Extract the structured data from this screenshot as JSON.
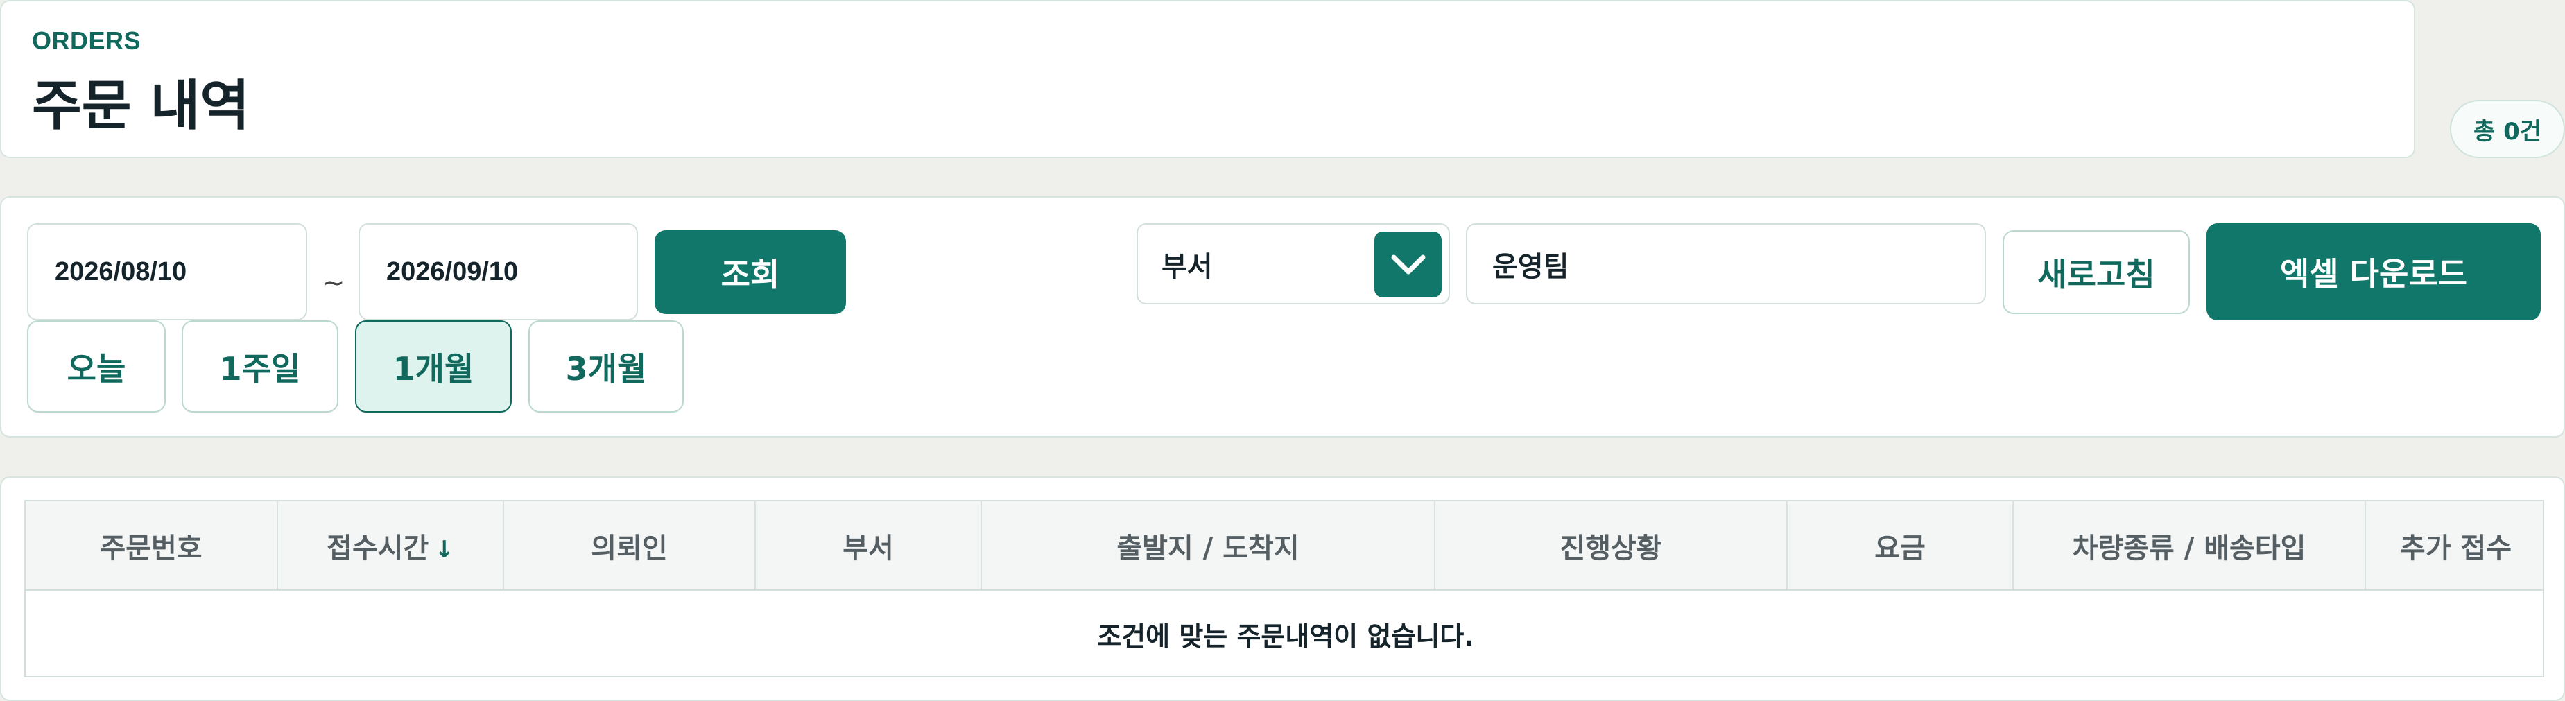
{
  "header": {
    "eyebrow": "ORDERS",
    "title": "주문 내역",
    "count_badge": "총 0건"
  },
  "filters": {
    "date_from": "2026/08/10",
    "tilde": "~",
    "date_to": "2026/09/10",
    "search_label": "조회",
    "quick_ranges": [
      "오늘",
      "1주일",
      "1개월",
      "3개월"
    ],
    "selected_range": "1개월",
    "dept_select_value": "부서",
    "dept_input_value": "운영팀",
    "refresh_label": "새로고침",
    "excel_label": "엑셀 다운로드"
  },
  "table": {
    "columns": [
      "주문번호",
      "접수시간",
      "의뢰인",
      "부서",
      "출발지 / 도착지",
      "진행상황",
      "요금",
      "차량종류 / 배송타입",
      "추가 접수"
    ],
    "sort_indicator": "↓",
    "empty_message": "조건에 맞는 주문내역이 없습니다."
  },
  "colors": {
    "accent": "#11776a",
    "accent_text": "#11695e",
    "selected_bg": "#dff3ee"
  }
}
